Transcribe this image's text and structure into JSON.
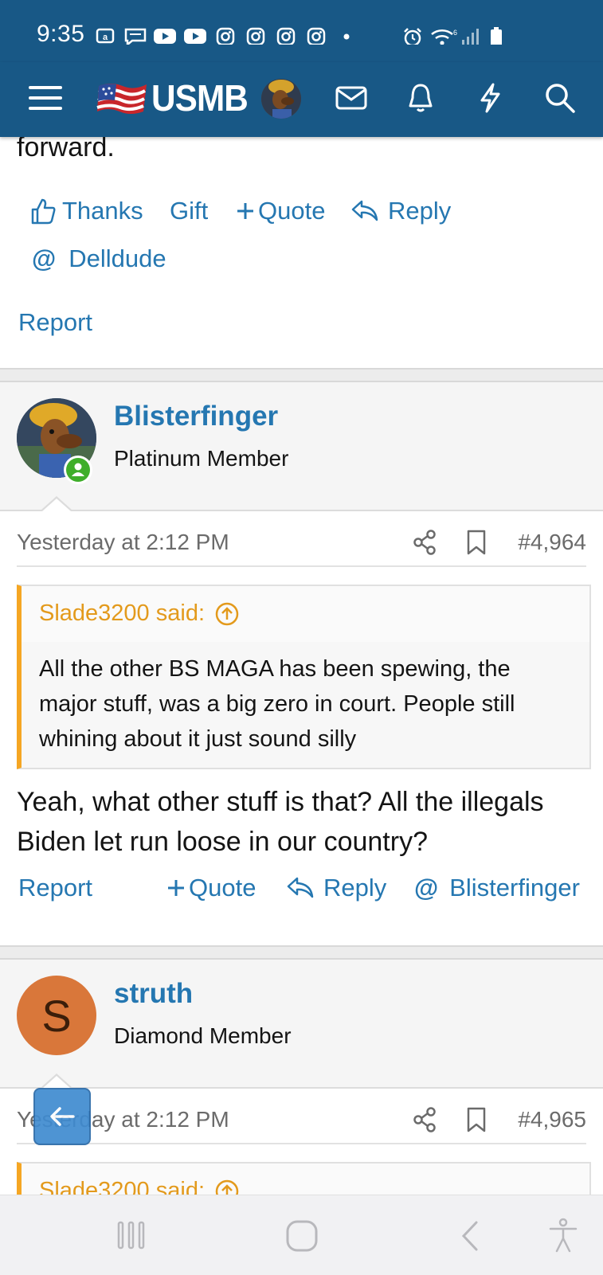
{
  "status_bar": {
    "time": "9:35",
    "icons": [
      "amazon-icon",
      "message-icon",
      "youtube-icon",
      "youtube-icon",
      "instagram-icon",
      "instagram-icon",
      "instagram-icon",
      "instagram-icon",
      "dot-icon",
      "alarm-icon",
      "wifi-icon",
      "signal-icon",
      "battery-icon"
    ]
  },
  "nav": {
    "logo_text": "USMB",
    "icons": [
      "menu-icon",
      "avatar",
      "inbox-icon",
      "bell-icon",
      "bolt-icon",
      "search-icon"
    ]
  },
  "prev_post": {
    "text_tail": "forward.",
    "actions": {
      "thanks": "Thanks",
      "gift": "Gift",
      "quote": "Quote",
      "reply": "Reply",
      "mention": "Delldude",
      "report": "Report"
    }
  },
  "post1": {
    "username": "Blisterfinger",
    "user_title": "Platinum Member",
    "date": "Yesterday at 2:12 PM",
    "post_number": "#4,964",
    "quote_author": "Slade3200 said:",
    "quote_text": "All the other BS MAGA has been spewing, the major stuff, was a big zero in court. People still whining about it just sound silly",
    "body": "Yeah, what other stuff is that? All the illegals Biden let run loose in our country?",
    "actions": {
      "report": "Report",
      "quote": "Quote",
      "reply": "Reply",
      "mention": "Blisterfinger"
    }
  },
  "post2": {
    "avatar_letter": "S",
    "username": "struth",
    "user_title": "Diamond Member",
    "date": "Yesterday at 2:12 PM",
    "post_number": "#4,965",
    "quote_author": "Slade3200 said:"
  },
  "colors": {
    "header": "#185886",
    "link": "#2577b1",
    "quote_accent": "#f5a623",
    "avatar_s": "#d9773a",
    "online": "#3fae2a"
  }
}
